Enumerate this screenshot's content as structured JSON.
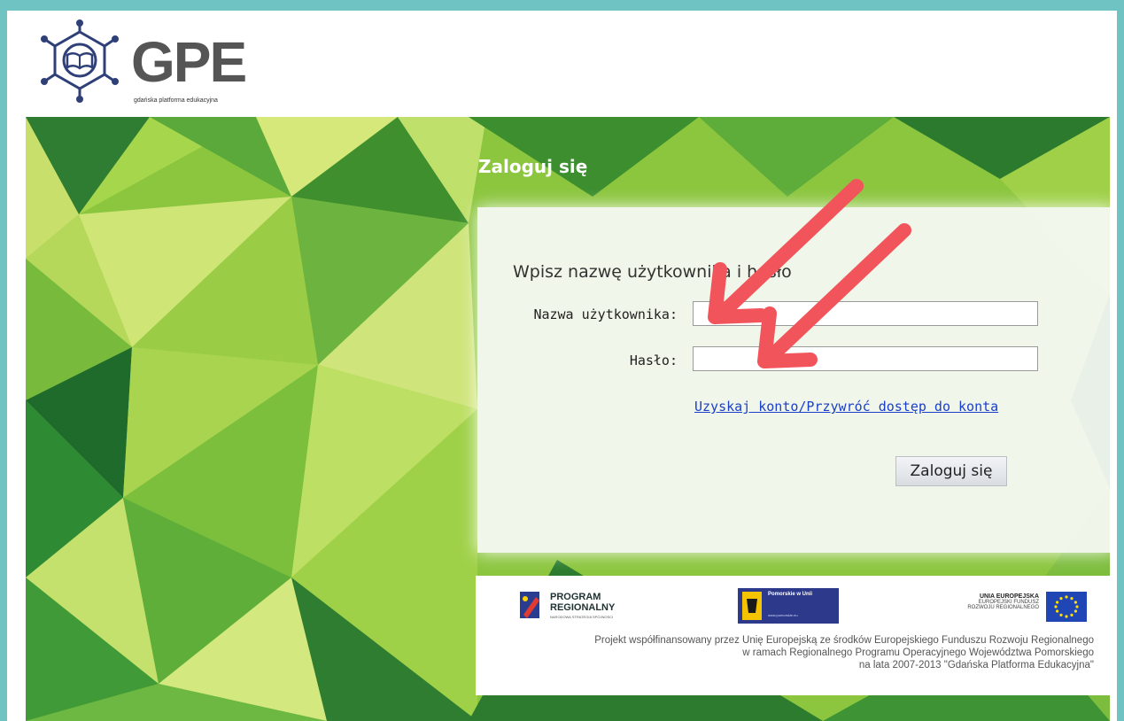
{
  "header": {
    "logo_text": "GPE",
    "logo_subtitle": "gdańska platforma edukacyjna"
  },
  "login": {
    "title": "Zaloguj się",
    "prompt": "Wpisz nazwę użytkownika i hasło",
    "username_label": "Nazwa użytkownika:",
    "username_value": "",
    "password_label": "Hasło:",
    "password_value": "",
    "recover_link": "Uzyskaj konto/Przywróć dostęp do konta",
    "submit_label": "Zaloguj się"
  },
  "footer": {
    "program_line1": "PROGRAM",
    "program_line2": "REGIONALNY",
    "program_line3": "NARODOWA STRATEGIA SPÓJNOŚCI",
    "pomorskie_title": "Pomorskie w Unii",
    "pomorskie_url": "www.pomorskie.eu",
    "ue_line1": "UNIA EUROPEJSKA",
    "ue_line2": "EUROPEJSKI FUNDUSZ",
    "ue_line3": "ROZWOJU REGIONALNEGO",
    "funding_line1": "Projekt współfinansowany przez Unię Europejską ze środków Europejskiego Funduszu Rozwoju Regionalnego",
    "funding_line2": "w ramach Regionalnego Programu Operacyjnego Województwa Pomorskiego",
    "funding_line3": "na lata 2007-2013 \"Gdańska Platforma Edukacyjna\""
  },
  "colors": {
    "frame": "#6fc3c3",
    "banner_green": "#8cc63f",
    "link": "#1a3fcc",
    "arrow": "#f2545b"
  }
}
